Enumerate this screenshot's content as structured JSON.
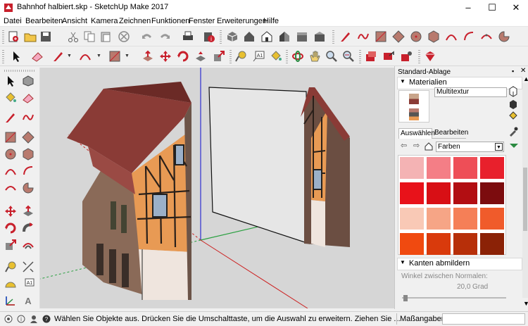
{
  "window": {
    "title": "Bahnhof halbiert.skp - SketchUp Make 2017"
  },
  "menu": [
    "Datei",
    "Bearbeiten",
    "Ansicht",
    "Kamera",
    "Zeichnen",
    "Funktionen",
    "Fenster",
    "Erweiterungen",
    "Hilfe"
  ],
  "tray": {
    "title": "Standard-Ablage",
    "materials_title": "Materialien",
    "material_name": "Multitextur",
    "tabs": [
      "Auswählen",
      "Bearbeiten"
    ],
    "collection": "Farben",
    "soften_title": "Kanten abmildern",
    "normals_label": "Winkel zwischen Normalen:",
    "angle_value": "20,0",
    "angle_unit": "Grad"
  },
  "swatches": [
    "#f4b3b4",
    "#f47e86",
    "#ee4e57",
    "#e8202c",
    "#e8121a",
    "#d80f15",
    "#b20e12",
    "#7c0c0e",
    "#f9c9b6",
    "#f6a586",
    "#f57f57",
    "#f05b2b",
    "#f04a10",
    "#d93a0c",
    "#b72f09",
    "#8b2206"
  ],
  "status": {
    "message": "Wählen Sie Objekte aus. Drücken Sie die Umschalttaste, um die Auswahl zu erweitern. Ziehen Sie ...",
    "measurements_label": "Maßangaben"
  },
  "colors": {
    "accent_red": "#c8202c",
    "viewport_bg": "#d6d6d6",
    "roof": "#8a3b36",
    "wall": "#e89a54"
  }
}
